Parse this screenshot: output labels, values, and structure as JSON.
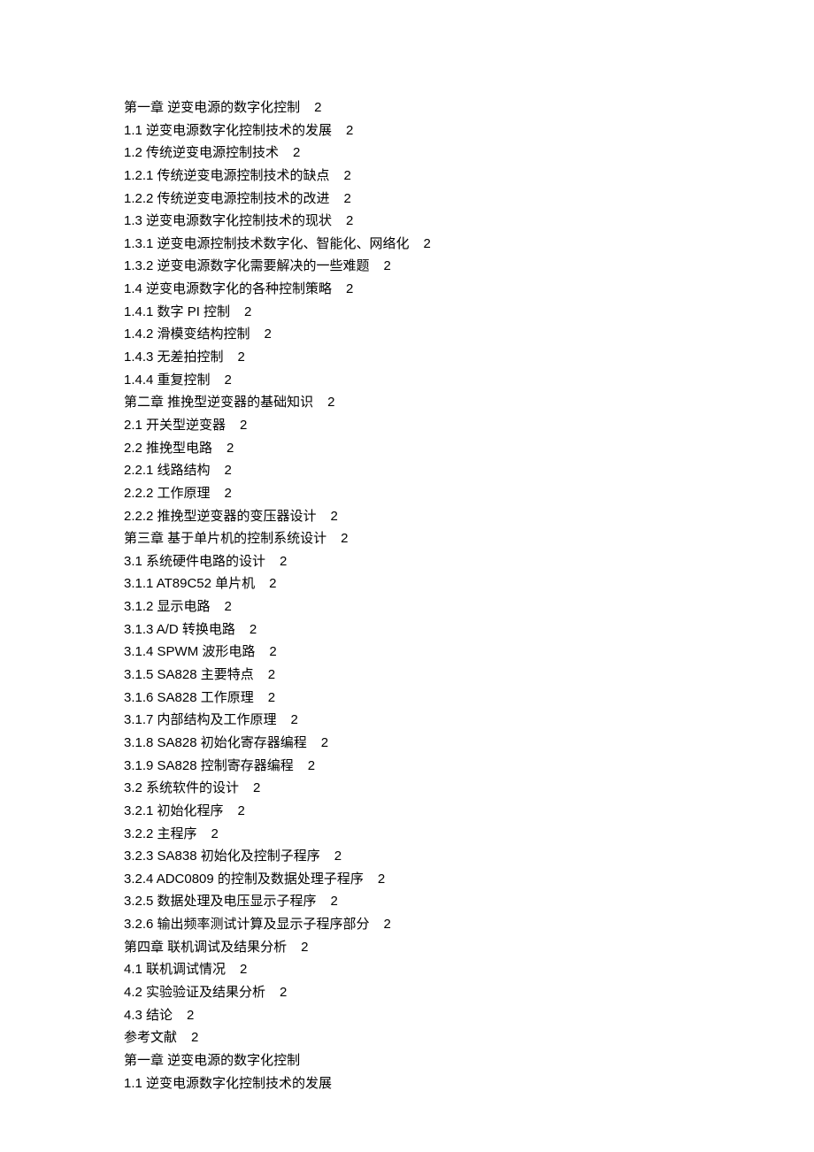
{
  "toc": [
    {
      "title": "第一章 逆变电源的数字化控制",
      "page": "2"
    },
    {
      "title": "1.1 逆变电源数字化控制技术的发展",
      "page": "2"
    },
    {
      "title": "1.2 传统逆变电源控制技术",
      "page": "2"
    },
    {
      "title": "1.2.1 传统逆变电源控制技术的缺点",
      "page": "2"
    },
    {
      "title": "1.2.2 传统逆变电源控制技术的改进",
      "page": "2"
    },
    {
      "title": "1.3 逆变电源数字化控制技术的现状",
      "page": "2"
    },
    {
      "title": "1.3.1 逆变电源控制技术数字化、智能化、网络化",
      "page": "2"
    },
    {
      "title": "1.3.2 逆变电源数字化需要解决的一些难题",
      "page": "2"
    },
    {
      "title": "1.4 逆变电源数字化的各种控制策略",
      "page": "2"
    },
    {
      "title": "1.4.1 数字 PI 控制",
      "page": "2"
    },
    {
      "title": "1.4.2 滑模变结构控制",
      "page": "2"
    },
    {
      "title": "1.4.3 无差拍控制",
      "page": "2"
    },
    {
      "title": "1.4.4 重复控制",
      "page": "2"
    },
    {
      "title": "第二章 推挽型逆变器的基础知识",
      "page": "2"
    },
    {
      "title": "2.1 开关型逆变器",
      "page": "2"
    },
    {
      "title": "2.2 推挽型电路",
      "page": "2"
    },
    {
      "title": "2.2.1 线路结构",
      "page": "2"
    },
    {
      "title": "2.2.2 工作原理",
      "page": "2"
    },
    {
      "title": "2.2.2 推挽型逆变器的变压器设计",
      "page": "2"
    },
    {
      "title": "第三章 基于单片机的控制系统设计",
      "page": "2"
    },
    {
      "title": "3.1 系统硬件电路的设计",
      "page": "2"
    },
    {
      "title": "3.1.1  AT89C52 单片机",
      "page": "2"
    },
    {
      "title": "3.1.2 显示电路",
      "page": "2"
    },
    {
      "title": "3.1.3 A/D 转换电路",
      "page": "2"
    },
    {
      "title": "3.1.4 SPWM 波形电路",
      "page": "2"
    },
    {
      "title": "3.1.5 SA828 主要特点",
      "page": "2"
    },
    {
      "title": "3.1.6 SA828 工作原理",
      "page": "2"
    },
    {
      "title": "3.1.7 内部结构及工作原理",
      "page": "2"
    },
    {
      "title": "3.1.8 SA828 初始化寄存器编程",
      "page": "2"
    },
    {
      "title": "3.1.9 SA828 控制寄存器编程",
      "page": "2"
    },
    {
      "title": "3.2 系统软件的设计",
      "page": "2"
    },
    {
      "title": "3.2.1 初始化程序",
      "page": "2"
    },
    {
      "title": "3.2.2 主程序",
      "page": "2"
    },
    {
      "title": "3.2.3 SA838 初始化及控制子程序",
      "page": "2"
    },
    {
      "title": "3.2.4 ADC0809 的控制及数据处理子程序",
      "page": "2"
    },
    {
      "title": "3.2.5 数据处理及电压显示子程序",
      "page": "2"
    },
    {
      "title": "3.2.6 输出频率测试计算及显示子程序部分",
      "page": "2"
    },
    {
      "title": "第四章    联机调试及结果分析",
      "page": "2"
    },
    {
      "title": "4.1 联机调试情况",
      "page": "2"
    },
    {
      "title": "4.2 实验验证及结果分析",
      "page": "2"
    },
    {
      "title": "4.3 结论",
      "page": "2"
    },
    {
      "title": "参考文献",
      "page": "2"
    }
  ],
  "body": [
    "第一章 逆变电源的数字化控制",
    "1.1 逆变电源数字化控制技术的发展"
  ]
}
